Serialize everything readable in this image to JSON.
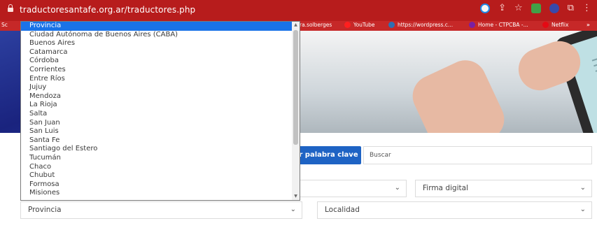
{
  "browser": {
    "url": "traductoresantafe.org.ar/traductores.php",
    "bookmarks": [
      {
        "label": "ra.solberges",
        "color": "#c62828"
      },
      {
        "label": "YouTube",
        "color": "#ff1f1f"
      },
      {
        "label": "https://wordpress.c...",
        "color": "#2f6fb3"
      },
      {
        "label": "Home - CTPCBA -...",
        "color": "#7b1fa2"
      },
      {
        "label": "Netflix",
        "color": "#e50914"
      }
    ],
    "overflow_label": "»",
    "left_tab_label": "Sc"
  },
  "search": {
    "button_label": "r palabra clave",
    "input_placeholder": "Buscar"
  },
  "filters": {
    "firma_label": "Firma digital",
    "provincia_label": "Provincia",
    "localidad_label": "Localidad"
  },
  "dropdown": {
    "selected_index": 0,
    "options": [
      "Provincia",
      "Ciudad Autónoma de Buenos Aires (CABA)",
      "Buenos Aires",
      "Catamarca",
      "Córdoba",
      "Corrientes",
      "Entre Ríos",
      "Jujuy",
      "Mendoza",
      "La Rioja",
      "Salta",
      "San Juan",
      "San Luis",
      "Santa Fe",
      "Santiago del Estero",
      "Tucumán",
      "Chaco",
      "Chubut",
      "Formosa",
      "Misiones"
    ]
  },
  "colors": {
    "browser_red": "#b71c1c",
    "accent_blue": "#1e63c4",
    "selected_blue": "#1a73e8"
  }
}
